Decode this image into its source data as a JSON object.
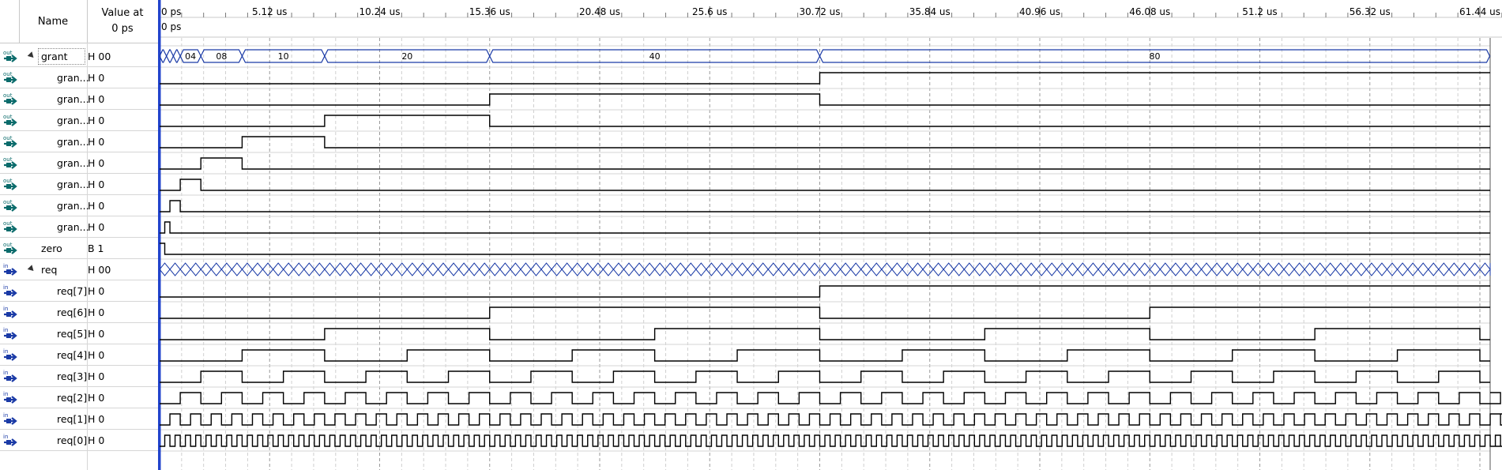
{
  "header": {
    "name_label": "Name",
    "value_label": "Value at",
    "value_time": "0 ps"
  },
  "cursor_label": "0 ps",
  "time_ticks": [
    "0 ps",
    "5.12 us",
    "10.24 us",
    "15.36 us",
    "20.48 us",
    "25.6 us",
    "30.72 us",
    "35.84 us",
    "40.96 us",
    "46.08 us",
    "51.2 us",
    "56.32 us",
    "61.44 us"
  ],
  "signals": [
    {
      "dir": "out",
      "name": "grant",
      "value": "H 00",
      "group": true
    },
    {
      "dir": "out",
      "name": "gran...",
      "value": "H 0"
    },
    {
      "dir": "out",
      "name": "gran...",
      "value": "H 0"
    },
    {
      "dir": "out",
      "name": "gran...",
      "value": "H 0"
    },
    {
      "dir": "out",
      "name": "gran...",
      "value": "H 0"
    },
    {
      "dir": "out",
      "name": "gran...",
      "value": "H 0"
    },
    {
      "dir": "out",
      "name": "gran...",
      "value": "H 0"
    },
    {
      "dir": "out",
      "name": "gran...",
      "value": "H 0"
    },
    {
      "dir": "out",
      "name": "gran...",
      "value": "H 0"
    },
    {
      "dir": "out",
      "name": "zero",
      "value": "B 1"
    },
    {
      "dir": "in",
      "name": "req",
      "value": "H 00",
      "group": true
    },
    {
      "dir": "in",
      "name": "req[7]",
      "value": "H 0"
    },
    {
      "dir": "in",
      "name": "req[6]",
      "value": "H 0"
    },
    {
      "dir": "in",
      "name": "req[5]",
      "value": "H 0"
    },
    {
      "dir": "in",
      "name": "req[4]",
      "value": "H 0"
    },
    {
      "dir": "in",
      "name": "req[3]",
      "value": "H 0"
    },
    {
      "dir": "in",
      "name": "req[2]",
      "value": "H 0"
    },
    {
      "dir": "in",
      "name": "req[1]",
      "value": "H 0"
    },
    {
      "dir": "in",
      "name": "req[0]",
      "value": "H 0"
    }
  ],
  "grant_bus_values": [
    "04",
    "08",
    "10",
    "20",
    "40",
    "80"
  ],
  "colors": {
    "bus": "#1a3aa6",
    "wave": "#000000",
    "grid": "#bfbfbf",
    "cursor": "#2244cc",
    "icon_out": "#0a6b6b",
    "icon_in": "#1a3aa6"
  }
}
